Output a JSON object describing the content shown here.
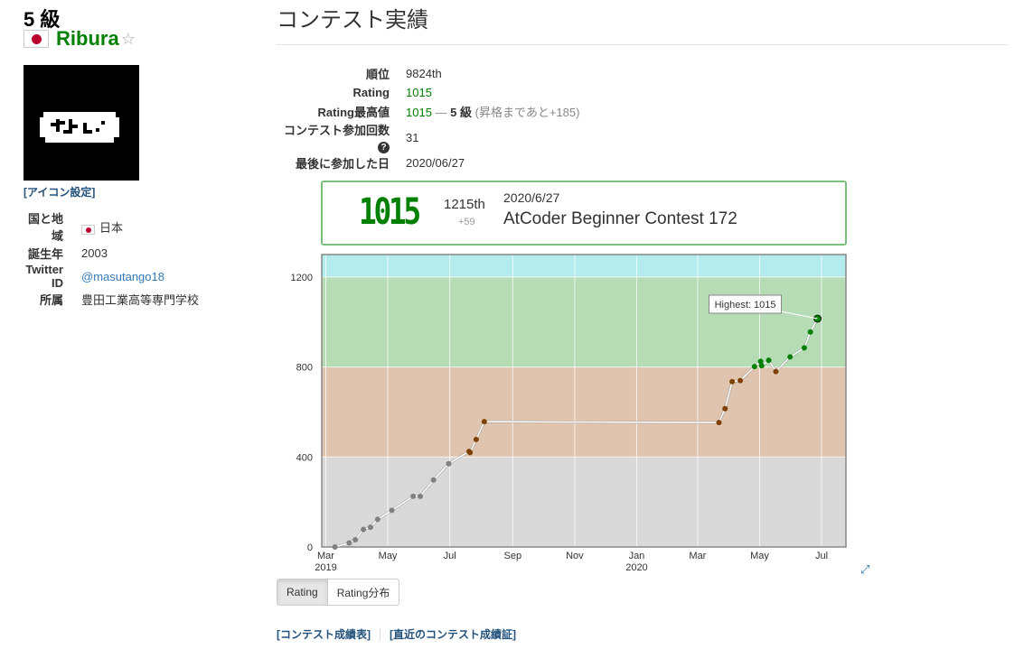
{
  "user": {
    "grade": "5 級",
    "name": "Ribura",
    "icon_setting": "[アイコン設定]"
  },
  "profile": [
    {
      "label": "国と地域",
      "value": "日本",
      "flag": true
    },
    {
      "label": "誕生年",
      "value": "2003"
    },
    {
      "label": "Twitter ID",
      "value": "@masutango18",
      "link": true
    },
    {
      "label": "所属",
      "value": "豊田工業高等専門学校"
    }
  ],
  "page_title": "コンテスト実績",
  "stats": {
    "rank_label": "順位",
    "rank": "9824th",
    "rating_label": "Rating",
    "rating": "1015",
    "max_label": "Rating最高値",
    "max_value": "1015",
    "max_sep": " — ",
    "max_grade": "5 級",
    "max_note": "(昇格まであと+185)",
    "count_label": "コンテスト参加回数",
    "count": "31",
    "last_label": "最後に参加した日",
    "last": "2020/06/27"
  },
  "status": {
    "rating": "1015",
    "rank": "1215th",
    "diff": "+59",
    "date": "2020/6/27",
    "contest": "AtCoder Beginner Contest 172"
  },
  "chart_data": {
    "type": "line",
    "ylim": [
      0,
      1300
    ],
    "xlim": [
      "2019-02-25",
      "2020-07-25"
    ],
    "y_ticks": [
      0,
      400,
      800,
      1200
    ],
    "x_ticks": [
      {
        "date": "2019-03-01",
        "label": "Mar",
        "sub": "2019"
      },
      {
        "date": "2019-05-01",
        "label": "May",
        "sub": ""
      },
      {
        "date": "2019-07-01",
        "label": "Jul",
        "sub": ""
      },
      {
        "date": "2019-09-01",
        "label": "Sep",
        "sub": ""
      },
      {
        "date": "2019-11-01",
        "label": "Nov",
        "sub": ""
      },
      {
        "date": "2020-01-01",
        "label": "Jan",
        "sub": "2020"
      },
      {
        "date": "2020-03-01",
        "label": "Mar",
        "sub": ""
      },
      {
        "date": "2020-05-01",
        "label": "May",
        "sub": ""
      },
      {
        "date": "2020-07-01",
        "label": "Jul",
        "sub": ""
      }
    ],
    "bands": [
      {
        "from": 0,
        "to": 400,
        "color": "#d9d9d9"
      },
      {
        "from": 400,
        "to": 800,
        "color": "#dfc4b0"
      },
      {
        "from": 800,
        "to": 1200,
        "color": "#b5dcb5"
      },
      {
        "from": 1200,
        "to": 1300,
        "color": "#b4ebec"
      }
    ],
    "points": [
      {
        "x": "2019-03-10",
        "y": 0
      },
      {
        "x": "2019-03-24",
        "y": 18
      },
      {
        "x": "2019-03-30",
        "y": 32
      },
      {
        "x": "2019-04-07",
        "y": 78
      },
      {
        "x": "2019-04-14",
        "y": 88
      },
      {
        "x": "2019-04-21",
        "y": 123
      },
      {
        "x": "2019-05-05",
        "y": 163
      },
      {
        "x": "2019-05-26",
        "y": 225
      },
      {
        "x": "2019-06-02",
        "y": 225
      },
      {
        "x": "2019-06-15",
        "y": 298
      },
      {
        "x": "2019-06-30",
        "y": 370
      },
      {
        "x": "2019-07-20",
        "y": 425
      },
      {
        "x": "2019-07-21",
        "y": 420
      },
      {
        "x": "2019-07-27",
        "y": 478
      },
      {
        "x": "2019-08-04",
        "y": 557
      },
      {
        "x": "2020-03-22",
        "y": 553
      },
      {
        "x": "2020-03-28",
        "y": 615
      },
      {
        "x": "2020-04-04",
        "y": 735
      },
      {
        "x": "2020-04-12",
        "y": 740
      },
      {
        "x": "2020-04-26",
        "y": 802
      },
      {
        "x": "2020-05-02",
        "y": 825
      },
      {
        "x": "2020-05-03",
        "y": 806
      },
      {
        "x": "2020-05-10",
        "y": 830
      },
      {
        "x": "2020-05-17",
        "y": 780
      },
      {
        "x": "2020-05-31",
        "y": 845
      },
      {
        "x": "2020-06-14",
        "y": 885
      },
      {
        "x": "2020-06-20",
        "y": 956
      },
      {
        "x": "2020-06-27",
        "y": 1015
      }
    ],
    "highest_label": "Highest: 1015"
  },
  "tabs": {
    "rating": "Rating",
    "dist": "Rating分布"
  },
  "footer": {
    "history": "[コンテスト成績表]",
    "certificate": "[直近のコンテスト成績証]"
  }
}
